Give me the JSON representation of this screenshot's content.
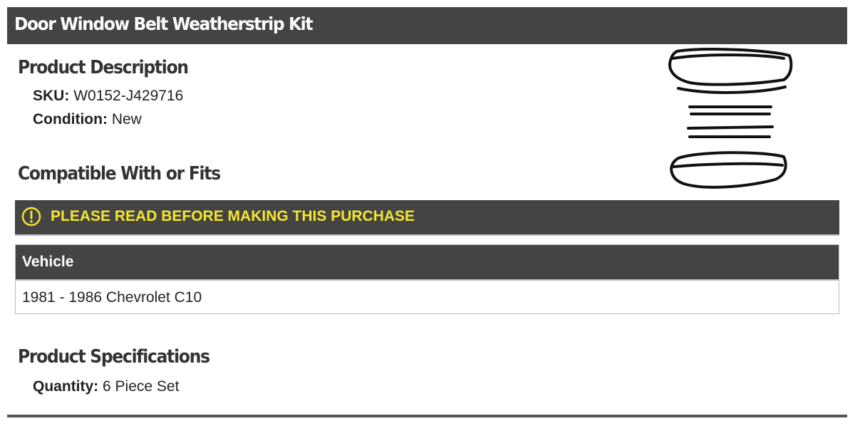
{
  "header": {
    "title": "Door Window Belt Weatherstrip Kit"
  },
  "description": {
    "heading": "Product Description",
    "sku_label": "SKU:",
    "sku_value": "W0152-J429716",
    "condition_label": "Condition:",
    "condition_value": "New"
  },
  "compatibility": {
    "heading": "Compatible With or Fits",
    "notice_icon": "exclamation-circle-icon",
    "notice_text": "PLEASE READ BEFORE MAKING THIS PURCHASE",
    "notice_color": "#f5e62b",
    "table": {
      "columns": [
        "Vehicle"
      ],
      "rows": [
        [
          "1981 - 1986 Chevrolet C10"
        ]
      ]
    }
  },
  "specifications": {
    "heading": "Product Specifications",
    "quantity_label": "Quantity:",
    "quantity_value": "6 Piece Set"
  },
  "image": {
    "icon": "weatherstrip-kit-illustration"
  },
  "colors": {
    "bar_background": "#444444",
    "heading_text": "#333333"
  }
}
